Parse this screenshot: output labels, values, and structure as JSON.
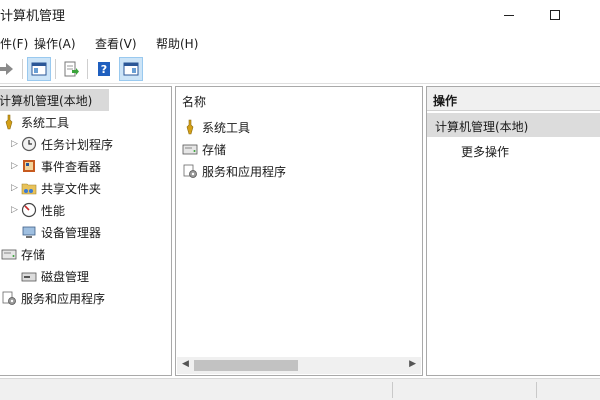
{
  "window": {
    "title": "计算机管理",
    "minimize_icon": "minimize-icon",
    "maximize_icon": "maximize-icon"
  },
  "menu": {
    "file": "件(F)",
    "action": "操作(A)",
    "view": "查看(V)",
    "help": "帮助(H)"
  },
  "toolbar": {
    "icons": [
      "forward-arrow-icon",
      "show-hide-console-tree-icon",
      "export-list-icon",
      "help-icon",
      "show-hide-action-pane-icon"
    ]
  },
  "tree": {
    "root": "计算机管理(本地)",
    "system_tools": "系统工具",
    "task_scheduler": "任务计划程序",
    "event_viewer": "事件查看器",
    "shared_folders": "共享文件夹",
    "performance": "性能",
    "device_manager": "设备管理器",
    "storage": "存储",
    "disk_management": "磁盘管理",
    "services_apps": "服务和应用程序"
  },
  "list": {
    "column_header": "名称",
    "items": [
      "系统工具",
      "存储",
      "服务和应用程序"
    ]
  },
  "actions": {
    "header": "操作",
    "selected": "计算机管理(本地)",
    "more": "更多操作"
  },
  "colors": {
    "selection": "#d9d9d9",
    "toolbar_pressed": "#cce4f7",
    "pane_border": "#a9a9a9",
    "help_blue": "#1f5fbf"
  }
}
